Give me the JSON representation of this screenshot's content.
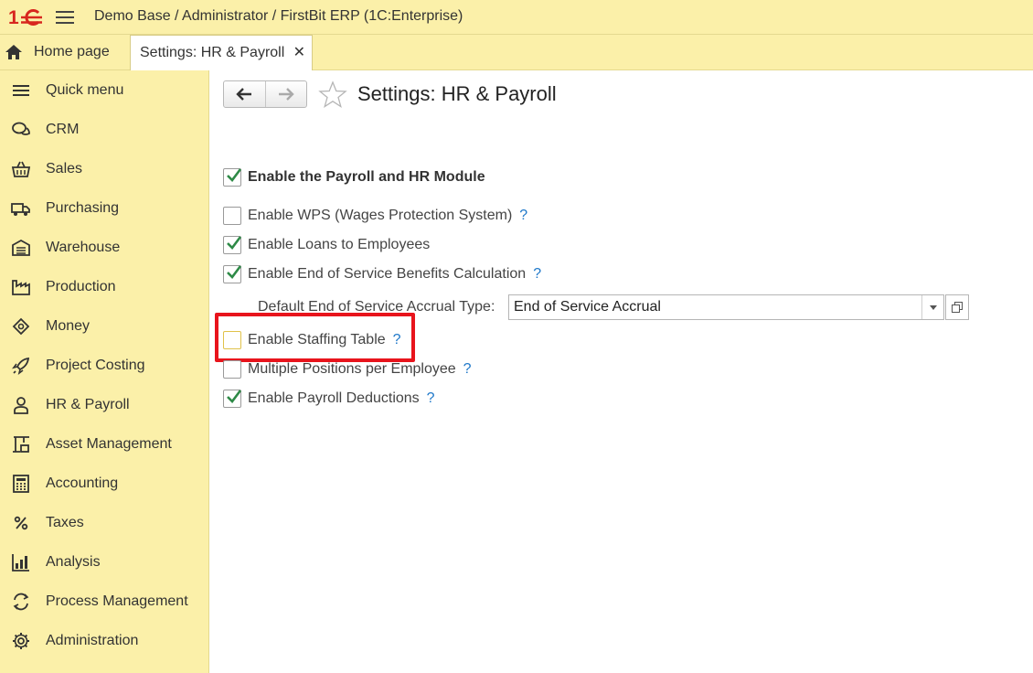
{
  "app": {
    "title": "Demo Base / Administrator / FirstBit ERP  (1C:Enterprise)",
    "logo": "1c-logo",
    "accent_color": "#fbf0a9"
  },
  "tabs": {
    "home_label": "Home page",
    "active_label": "Settings: HR & Payroll",
    "close_glyph": "✕"
  },
  "sidebar": {
    "items": [
      {
        "label": "Quick menu",
        "icon": "hamburger-icon"
      },
      {
        "label": "CRM",
        "icon": "chat-icon"
      },
      {
        "label": "Sales",
        "icon": "basket-icon"
      },
      {
        "label": "Purchasing",
        "icon": "truck-icon"
      },
      {
        "label": "Warehouse",
        "icon": "warehouse-icon"
      },
      {
        "label": "Production",
        "icon": "factory-icon"
      },
      {
        "label": "Money",
        "icon": "money-icon"
      },
      {
        "label": "Project Costing",
        "icon": "rocket-icon"
      },
      {
        "label": "HR & Payroll",
        "icon": "person-icon"
      },
      {
        "label": "Asset Management",
        "icon": "crane-icon"
      },
      {
        "label": "Accounting",
        "icon": "calculator-icon"
      },
      {
        "label": "Taxes",
        "icon": "percent-icon"
      },
      {
        "label": "Analysis",
        "icon": "bar-chart-icon"
      },
      {
        "label": "Process Management",
        "icon": "cycle-icon"
      },
      {
        "label": "Administration",
        "icon": "gear-icon"
      }
    ]
  },
  "form": {
    "title": "Settings: HR & Payroll",
    "options": [
      {
        "label": "Enable the Payroll and HR Module",
        "checked": true,
        "help": "",
        "bold": true
      },
      {
        "label": "Enable WPS (Wages Protection System)",
        "checked": false,
        "help": "?"
      },
      {
        "label": "Enable Loans to Employees",
        "checked": true,
        "help": ""
      },
      {
        "label": "Enable End of Service Benefits Calculation",
        "checked": true,
        "help": "?"
      },
      {
        "label": "Enable Staffing Table",
        "checked": false,
        "help": "?"
      },
      {
        "label": "Multiple Positions per Employee",
        "checked": false,
        "help": "?"
      },
      {
        "label": "Enable Payroll Deductions",
        "checked": true,
        "help": "?"
      }
    ],
    "accrual_type": {
      "label": "Default End of Service Accrual Type:",
      "value": "End of Service Accrual"
    }
  }
}
